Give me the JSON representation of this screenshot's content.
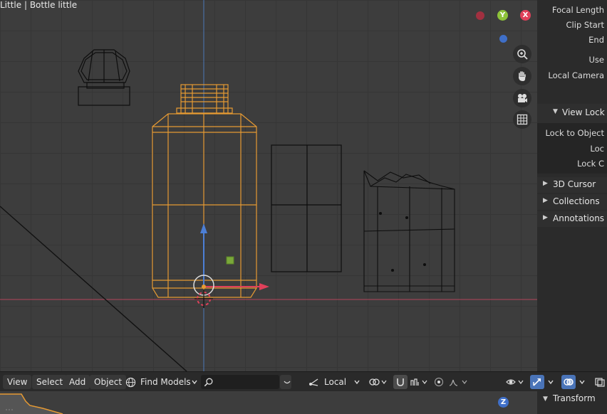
{
  "viewport": {
    "title": "Little | Bottle little",
    "gizmo": {
      "y_label": "Y",
      "x_label": "X",
      "z_label": "Z"
    },
    "nav_icons": [
      "zoom-icon",
      "hand-pan-icon",
      "camera-icon",
      "grid-icon"
    ]
  },
  "sidebar": {
    "focal_length": "Focal Length",
    "clip_start": "Clip Start",
    "clip_end": "End",
    "use": "Use",
    "local_camera": "Local Camera",
    "view_lock_header": "View Lock",
    "lock_to_object": "Lock to Object",
    "lock_1": "Loc",
    "lock_2": "Lock C",
    "sections": [
      {
        "label": "3D Cursor"
      },
      {
        "label": "Collections"
      },
      {
        "label": "Annotations"
      }
    ],
    "transform_header": "Transform"
  },
  "header": {
    "menu": [
      "View",
      "Select",
      "Add",
      "Object"
    ],
    "find_models": "Find Models",
    "search_placeholder": "",
    "orientation": "Local"
  },
  "colors": {
    "selected_outline": "#e69a33",
    "x_axis": "#e0405a",
    "y_axis": "#8ec33a",
    "z_axis": "#4c7fd6"
  }
}
